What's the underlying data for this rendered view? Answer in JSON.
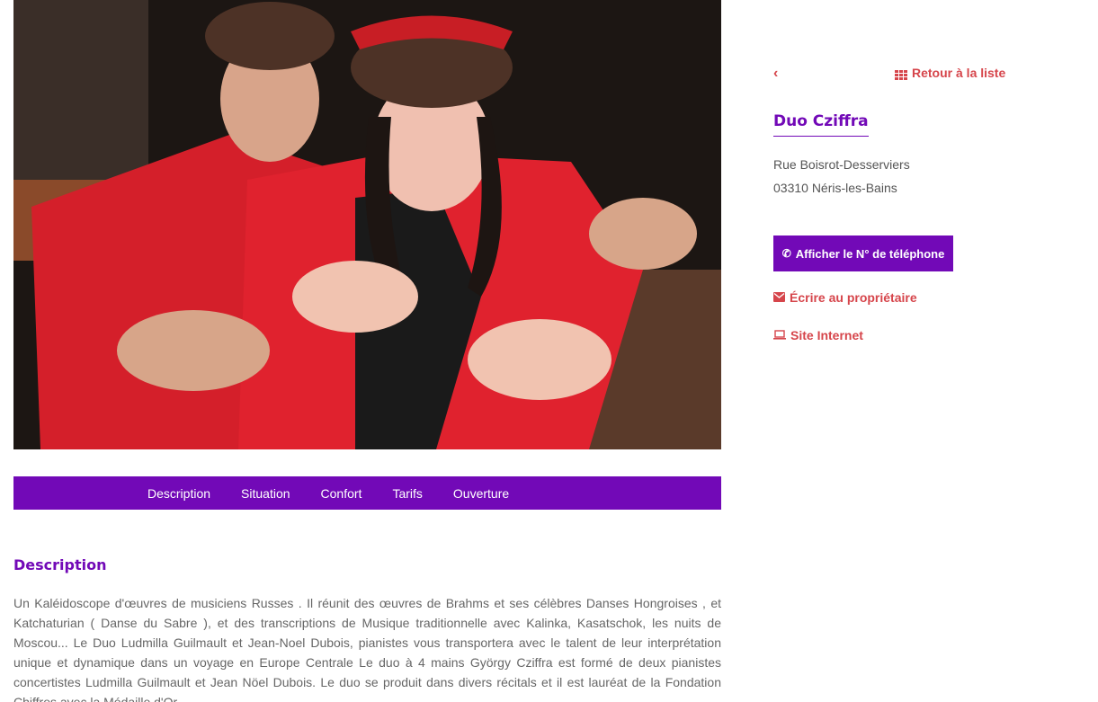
{
  "photo": {
    "alt_subject": "duo-photo"
  },
  "tabs": [
    {
      "label": "Description"
    },
    {
      "label": "Situation"
    },
    {
      "label": "Confort"
    },
    {
      "label": "Tarifs"
    },
    {
      "label": "Ouverture"
    }
  ],
  "description": {
    "title": "Description",
    "text": "Un Kaléidoscope d'œuvres de musiciens Russes . Il réunit des œuvres de Brahms et ses célèbres Danses Hongroises , et Katchaturian ( Danse du Sabre ), et des transcriptions de Musique traditionnelle avec Kalinka, Kasatschok, les nuits de Moscou... Le Duo Ludmilla Guilmault et Jean-Noel Dubois, pianistes vous transportera avec le talent de leur interprétation unique et dynamique dans un voyage en Europe Centrale Le duo à 4 mains György Cziffra est formé de deux pianistes concertistes Ludmilla Guilmault et Jean Nöel Dubois. Le duo se produit dans divers récitals et il est lauréat de la Fondation Chiffres avec la Médaille d'Or"
  },
  "sidebar": {
    "back_arrow": "‹",
    "back_list_label": "Retour à la liste",
    "name": "Duo Cziffra",
    "address_line1": "Rue Boisrot-Desserviers",
    "address_line2": "03310 Néris-les-Bains",
    "phone_button_label": "Afficher le N° de téléphone",
    "email_label": "Écrire au propriétaire",
    "website_label": "Site Internet"
  },
  "colors": {
    "accent": "#7209b7",
    "link": "#d6454b"
  }
}
